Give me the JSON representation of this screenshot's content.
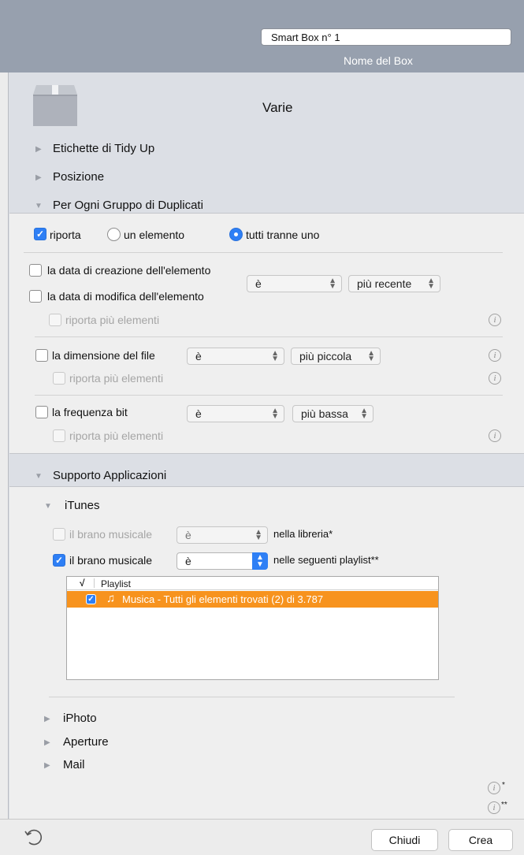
{
  "header": {
    "box_name_value": "Smart Box n° 1",
    "box_name_label": "Nome del Box"
  },
  "category": {
    "title": "Varie",
    "icon": "box-icon"
  },
  "sections": {
    "tidy_up_labels": "Etichette di Tidy Up",
    "position": "Posizione",
    "per_duplicate_group": "Per Ogni Gruppo di Duplicati",
    "app_support": "Supporto Applicazioni"
  },
  "duplicates": {
    "report_label": "riporta",
    "report_checked": true,
    "radio_one": "un elemento",
    "radio_all_but_one": "tutti tranne uno",
    "radio_selected": "tutti tranne uno",
    "creation_date": "la data di creazione dell'elemento",
    "modification_date": "la data di modifica dell'elemento",
    "date_operator": "è",
    "date_value": "più recente",
    "report_more": "riporta più elementi",
    "file_size": "la dimensione del file",
    "size_operator": "è",
    "size_value": "più piccola",
    "bitrate": "la frequenza bit",
    "bitrate_operator": "è",
    "bitrate_value": "più bassa",
    "info_glyph": "i"
  },
  "apps": {
    "itunes": "iTunes",
    "track_label": "il brano musicale",
    "operator": "è",
    "in_library": "nella libreria*",
    "in_playlists": "nelle seguenti playlist**",
    "library_checked": false,
    "playlists_checked": true,
    "table_check_header": "√",
    "table_playlist_header": "Playlist",
    "playlist_row": "Musica - Tutti gli elementi trovati (2) di 3.787",
    "playlist_row_checked": true,
    "iphoto": "iPhoto",
    "aperture": "Aperture",
    "mail": "Mail",
    "footnote1_mark": "*",
    "footnote2_mark": "**"
  },
  "footer": {
    "close_label": "Chiudi",
    "create_label": "Crea",
    "reset_icon": "reset-icon"
  },
  "colors": {
    "header_bg": "#97a0ae",
    "accent": "#2e7ff5",
    "selection": "#f7931e"
  }
}
